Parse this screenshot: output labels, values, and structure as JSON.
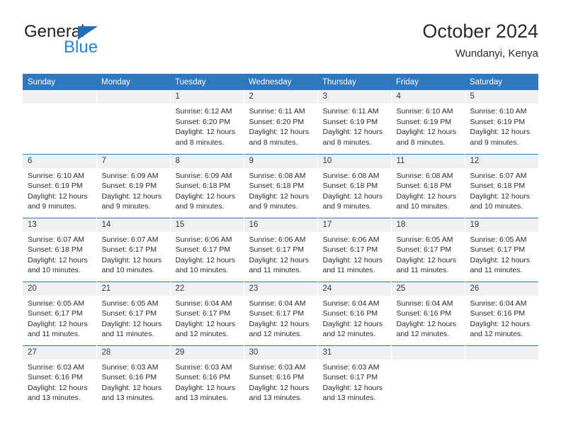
{
  "brand": {
    "name_top": "General",
    "name_bottom": "Blue",
    "accent_color": "#2585d3",
    "triangle_color": "#1f6fb2"
  },
  "header": {
    "title": "October 2024",
    "subtitle": "Wundanyi, Kenya"
  },
  "theme": {
    "header_row_bg": "#2f78bf",
    "header_row_text": "#ffffff",
    "daynum_bg": "#f0f0f0",
    "week_separator": "#2f78bf"
  },
  "weekday_headers": [
    "Sunday",
    "Monday",
    "Tuesday",
    "Wednesday",
    "Thursday",
    "Friday",
    "Saturday"
  ],
  "weeks": [
    [
      {
        "day": ""
      },
      {
        "day": ""
      },
      {
        "day": "1",
        "sunrise": "Sunrise: 6:12 AM",
        "sunset": "Sunset: 6:20 PM",
        "daylight": "Daylight: 12 hours and 8 minutes."
      },
      {
        "day": "2",
        "sunrise": "Sunrise: 6:11 AM",
        "sunset": "Sunset: 6:20 PM",
        "daylight": "Daylight: 12 hours and 8 minutes."
      },
      {
        "day": "3",
        "sunrise": "Sunrise: 6:11 AM",
        "sunset": "Sunset: 6:19 PM",
        "daylight": "Daylight: 12 hours and 8 minutes."
      },
      {
        "day": "4",
        "sunrise": "Sunrise: 6:10 AM",
        "sunset": "Sunset: 6:19 PM",
        "daylight": "Daylight: 12 hours and 8 minutes."
      },
      {
        "day": "5",
        "sunrise": "Sunrise: 6:10 AM",
        "sunset": "Sunset: 6:19 PM",
        "daylight": "Daylight: 12 hours and 9 minutes."
      }
    ],
    [
      {
        "day": "6",
        "sunrise": "Sunrise: 6:10 AM",
        "sunset": "Sunset: 6:19 PM",
        "daylight": "Daylight: 12 hours and 9 minutes."
      },
      {
        "day": "7",
        "sunrise": "Sunrise: 6:09 AM",
        "sunset": "Sunset: 6:19 PM",
        "daylight": "Daylight: 12 hours and 9 minutes."
      },
      {
        "day": "8",
        "sunrise": "Sunrise: 6:09 AM",
        "sunset": "Sunset: 6:18 PM",
        "daylight": "Daylight: 12 hours and 9 minutes."
      },
      {
        "day": "9",
        "sunrise": "Sunrise: 6:08 AM",
        "sunset": "Sunset: 6:18 PM",
        "daylight": "Daylight: 12 hours and 9 minutes."
      },
      {
        "day": "10",
        "sunrise": "Sunrise: 6:08 AM",
        "sunset": "Sunset: 6:18 PM",
        "daylight": "Daylight: 12 hours and 9 minutes."
      },
      {
        "day": "11",
        "sunrise": "Sunrise: 6:08 AM",
        "sunset": "Sunset: 6:18 PM",
        "daylight": "Daylight: 12 hours and 10 minutes."
      },
      {
        "day": "12",
        "sunrise": "Sunrise: 6:07 AM",
        "sunset": "Sunset: 6:18 PM",
        "daylight": "Daylight: 12 hours and 10 minutes."
      }
    ],
    [
      {
        "day": "13",
        "sunrise": "Sunrise: 6:07 AM",
        "sunset": "Sunset: 6:18 PM",
        "daylight": "Daylight: 12 hours and 10 minutes."
      },
      {
        "day": "14",
        "sunrise": "Sunrise: 6:07 AM",
        "sunset": "Sunset: 6:17 PM",
        "daylight": "Daylight: 12 hours and 10 minutes."
      },
      {
        "day": "15",
        "sunrise": "Sunrise: 6:06 AM",
        "sunset": "Sunset: 6:17 PM",
        "daylight": "Daylight: 12 hours and 10 minutes."
      },
      {
        "day": "16",
        "sunrise": "Sunrise: 6:06 AM",
        "sunset": "Sunset: 6:17 PM",
        "daylight": "Daylight: 12 hours and 11 minutes."
      },
      {
        "day": "17",
        "sunrise": "Sunrise: 6:06 AM",
        "sunset": "Sunset: 6:17 PM",
        "daylight": "Daylight: 12 hours and 11 minutes."
      },
      {
        "day": "18",
        "sunrise": "Sunrise: 6:05 AM",
        "sunset": "Sunset: 6:17 PM",
        "daylight": "Daylight: 12 hours and 11 minutes."
      },
      {
        "day": "19",
        "sunrise": "Sunrise: 6:05 AM",
        "sunset": "Sunset: 6:17 PM",
        "daylight": "Daylight: 12 hours and 11 minutes."
      }
    ],
    [
      {
        "day": "20",
        "sunrise": "Sunrise: 6:05 AM",
        "sunset": "Sunset: 6:17 PM",
        "daylight": "Daylight: 12 hours and 11 minutes."
      },
      {
        "day": "21",
        "sunrise": "Sunrise: 6:05 AM",
        "sunset": "Sunset: 6:17 PM",
        "daylight": "Daylight: 12 hours and 11 minutes."
      },
      {
        "day": "22",
        "sunrise": "Sunrise: 6:04 AM",
        "sunset": "Sunset: 6:17 PM",
        "daylight": "Daylight: 12 hours and 12 minutes."
      },
      {
        "day": "23",
        "sunrise": "Sunrise: 6:04 AM",
        "sunset": "Sunset: 6:17 PM",
        "daylight": "Daylight: 12 hours and 12 minutes."
      },
      {
        "day": "24",
        "sunrise": "Sunrise: 6:04 AM",
        "sunset": "Sunset: 6:16 PM",
        "daylight": "Daylight: 12 hours and 12 minutes."
      },
      {
        "day": "25",
        "sunrise": "Sunrise: 6:04 AM",
        "sunset": "Sunset: 6:16 PM",
        "daylight": "Daylight: 12 hours and 12 minutes."
      },
      {
        "day": "26",
        "sunrise": "Sunrise: 6:04 AM",
        "sunset": "Sunset: 6:16 PM",
        "daylight": "Daylight: 12 hours and 12 minutes."
      }
    ],
    [
      {
        "day": "27",
        "sunrise": "Sunrise: 6:03 AM",
        "sunset": "Sunset: 6:16 PM",
        "daylight": "Daylight: 12 hours and 13 minutes."
      },
      {
        "day": "28",
        "sunrise": "Sunrise: 6:03 AM",
        "sunset": "Sunset: 6:16 PM",
        "daylight": "Daylight: 12 hours and 13 minutes."
      },
      {
        "day": "29",
        "sunrise": "Sunrise: 6:03 AM",
        "sunset": "Sunset: 6:16 PM",
        "daylight": "Daylight: 12 hours and 13 minutes."
      },
      {
        "day": "30",
        "sunrise": "Sunrise: 6:03 AM",
        "sunset": "Sunset: 6:16 PM",
        "daylight": "Daylight: 12 hours and 13 minutes."
      },
      {
        "day": "31",
        "sunrise": "Sunrise: 6:03 AM",
        "sunset": "Sunset: 6:17 PM",
        "daylight": "Daylight: 12 hours and 13 minutes."
      },
      {
        "day": ""
      },
      {
        "day": ""
      }
    ]
  ]
}
